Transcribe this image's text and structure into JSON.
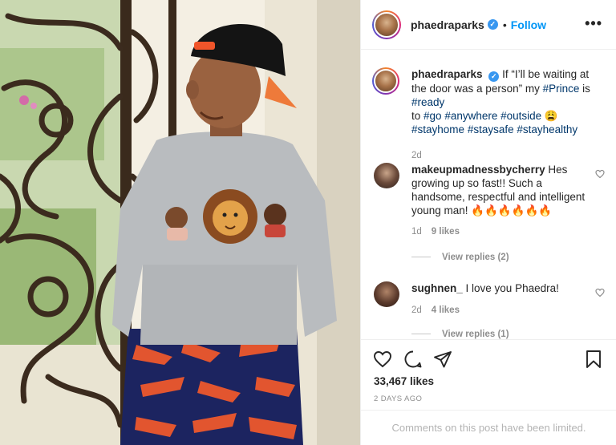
{
  "post": {
    "username": "phaedraparks",
    "verified_mark": "✓",
    "separator": "•",
    "follow_label": "Follow",
    "more_label": "•••"
  },
  "caption": {
    "username": "phaedraparks",
    "text_1": "If “I’ll be waiting at the door was a person” my ",
    "tag_prince": "#Prince",
    "text_2": " is ",
    "tag_ready": "#ready",
    "text_3": " to ",
    "tag_go": "#go",
    "text_4": " ",
    "tag_anywhere": "#anywhere",
    "text_5": " ",
    "tag_outside": "#outside",
    "emoji": " 😩",
    "tag_stayhome": "#stayhome",
    "tag_staysafe": "#staysafe",
    "tag_stayhealthy": "#stayhealthy",
    "age": "2d"
  },
  "comments": [
    {
      "username": "makeupmadnessbycherry",
      "text": "Hes growing up so fast!! Such a handsome, respectful and intelligent young man! 🔥🔥🔥🔥🔥🔥",
      "age": "1d",
      "likes": "9 likes",
      "replies": "View replies (2)"
    },
    {
      "username": "sughnen_",
      "text": "I love you Phaedra!",
      "age": "2d",
      "likes": "4 likes",
      "replies": "View replies (1)"
    }
  ],
  "actions": {
    "like_icon": "heart-icon",
    "comment_icon": "comment-icon",
    "share_icon": "share-icon",
    "save_icon": "bookmark-icon"
  },
  "likes_count": "33,467 likes",
  "posted_ago": "2 DAYS AGO",
  "comments_limited": "Comments on this post have been limited.",
  "colors": {
    "accent": "#0095f6",
    "hashtag": "#00376b",
    "muted": "#8e8e8e",
    "verified": "#3897f0"
  }
}
